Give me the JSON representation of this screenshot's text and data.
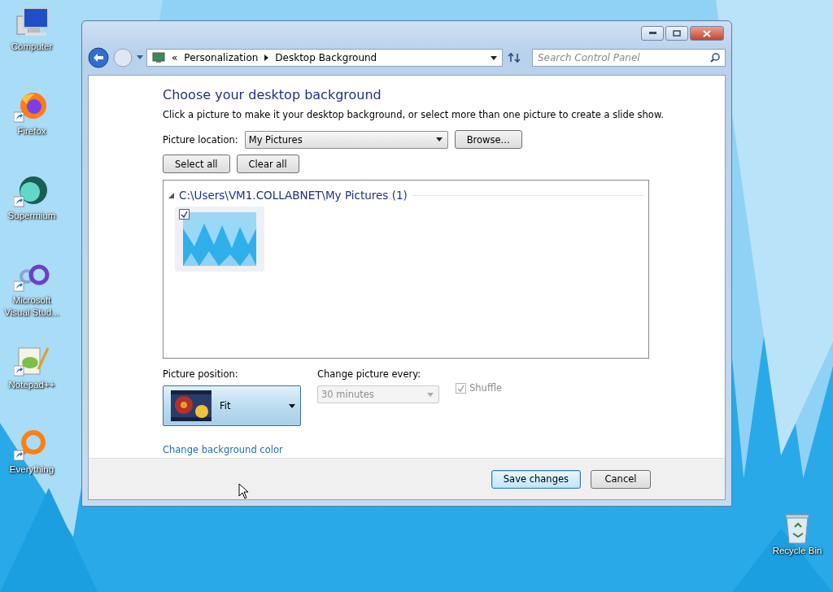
{
  "desktop_icons": [
    {
      "kind": "computer",
      "label": "Computer"
    },
    {
      "kind": "firefox",
      "label": "Firefox"
    },
    {
      "kind": "supermium",
      "label": "Supermium"
    },
    {
      "kind": "studio",
      "label": "Microsoft Visual Stud..."
    },
    {
      "kind": "notepad",
      "label": "Notepad++"
    },
    {
      "kind": "everything",
      "label": "Everything"
    }
  ],
  "recycle_bin": {
    "label": "Recycle Bin"
  },
  "address_bar": {
    "overflow": "«",
    "breadcrumbs": [
      "Personalization",
      "Desktop Background"
    ]
  },
  "search": {
    "placeholder": "Search Control Panel"
  },
  "heading": "Choose your desktop background",
  "description": "Click a picture to make it your desktop background, or select more than one picture to create a slide show.",
  "picture_location": {
    "label": "Picture location:",
    "value": "My Pictures"
  },
  "browse_button": "Browse...",
  "select_buttons": [
    "Select all",
    "Clear all"
  ],
  "gallery": {
    "group_title": "C:\\Users\\VM1.COLLABNET\\My Pictures (1)",
    "expanded": true,
    "pictures": [
      {
        "kind": "picture",
        "checked": true
      }
    ]
  },
  "picture_position": {
    "label": "Picture position:",
    "value": "Fit"
  },
  "change_every": {
    "label": "Change picture every:",
    "value": "30 minutes",
    "disabled": true
  },
  "shuffle": {
    "label": "Shuffle",
    "checked": true,
    "disabled": true
  },
  "link": "Change background color",
  "buttons": [
    {
      "label": "Save changes",
      "default": true
    },
    {
      "label": "Cancel",
      "default": false
    }
  ]
}
